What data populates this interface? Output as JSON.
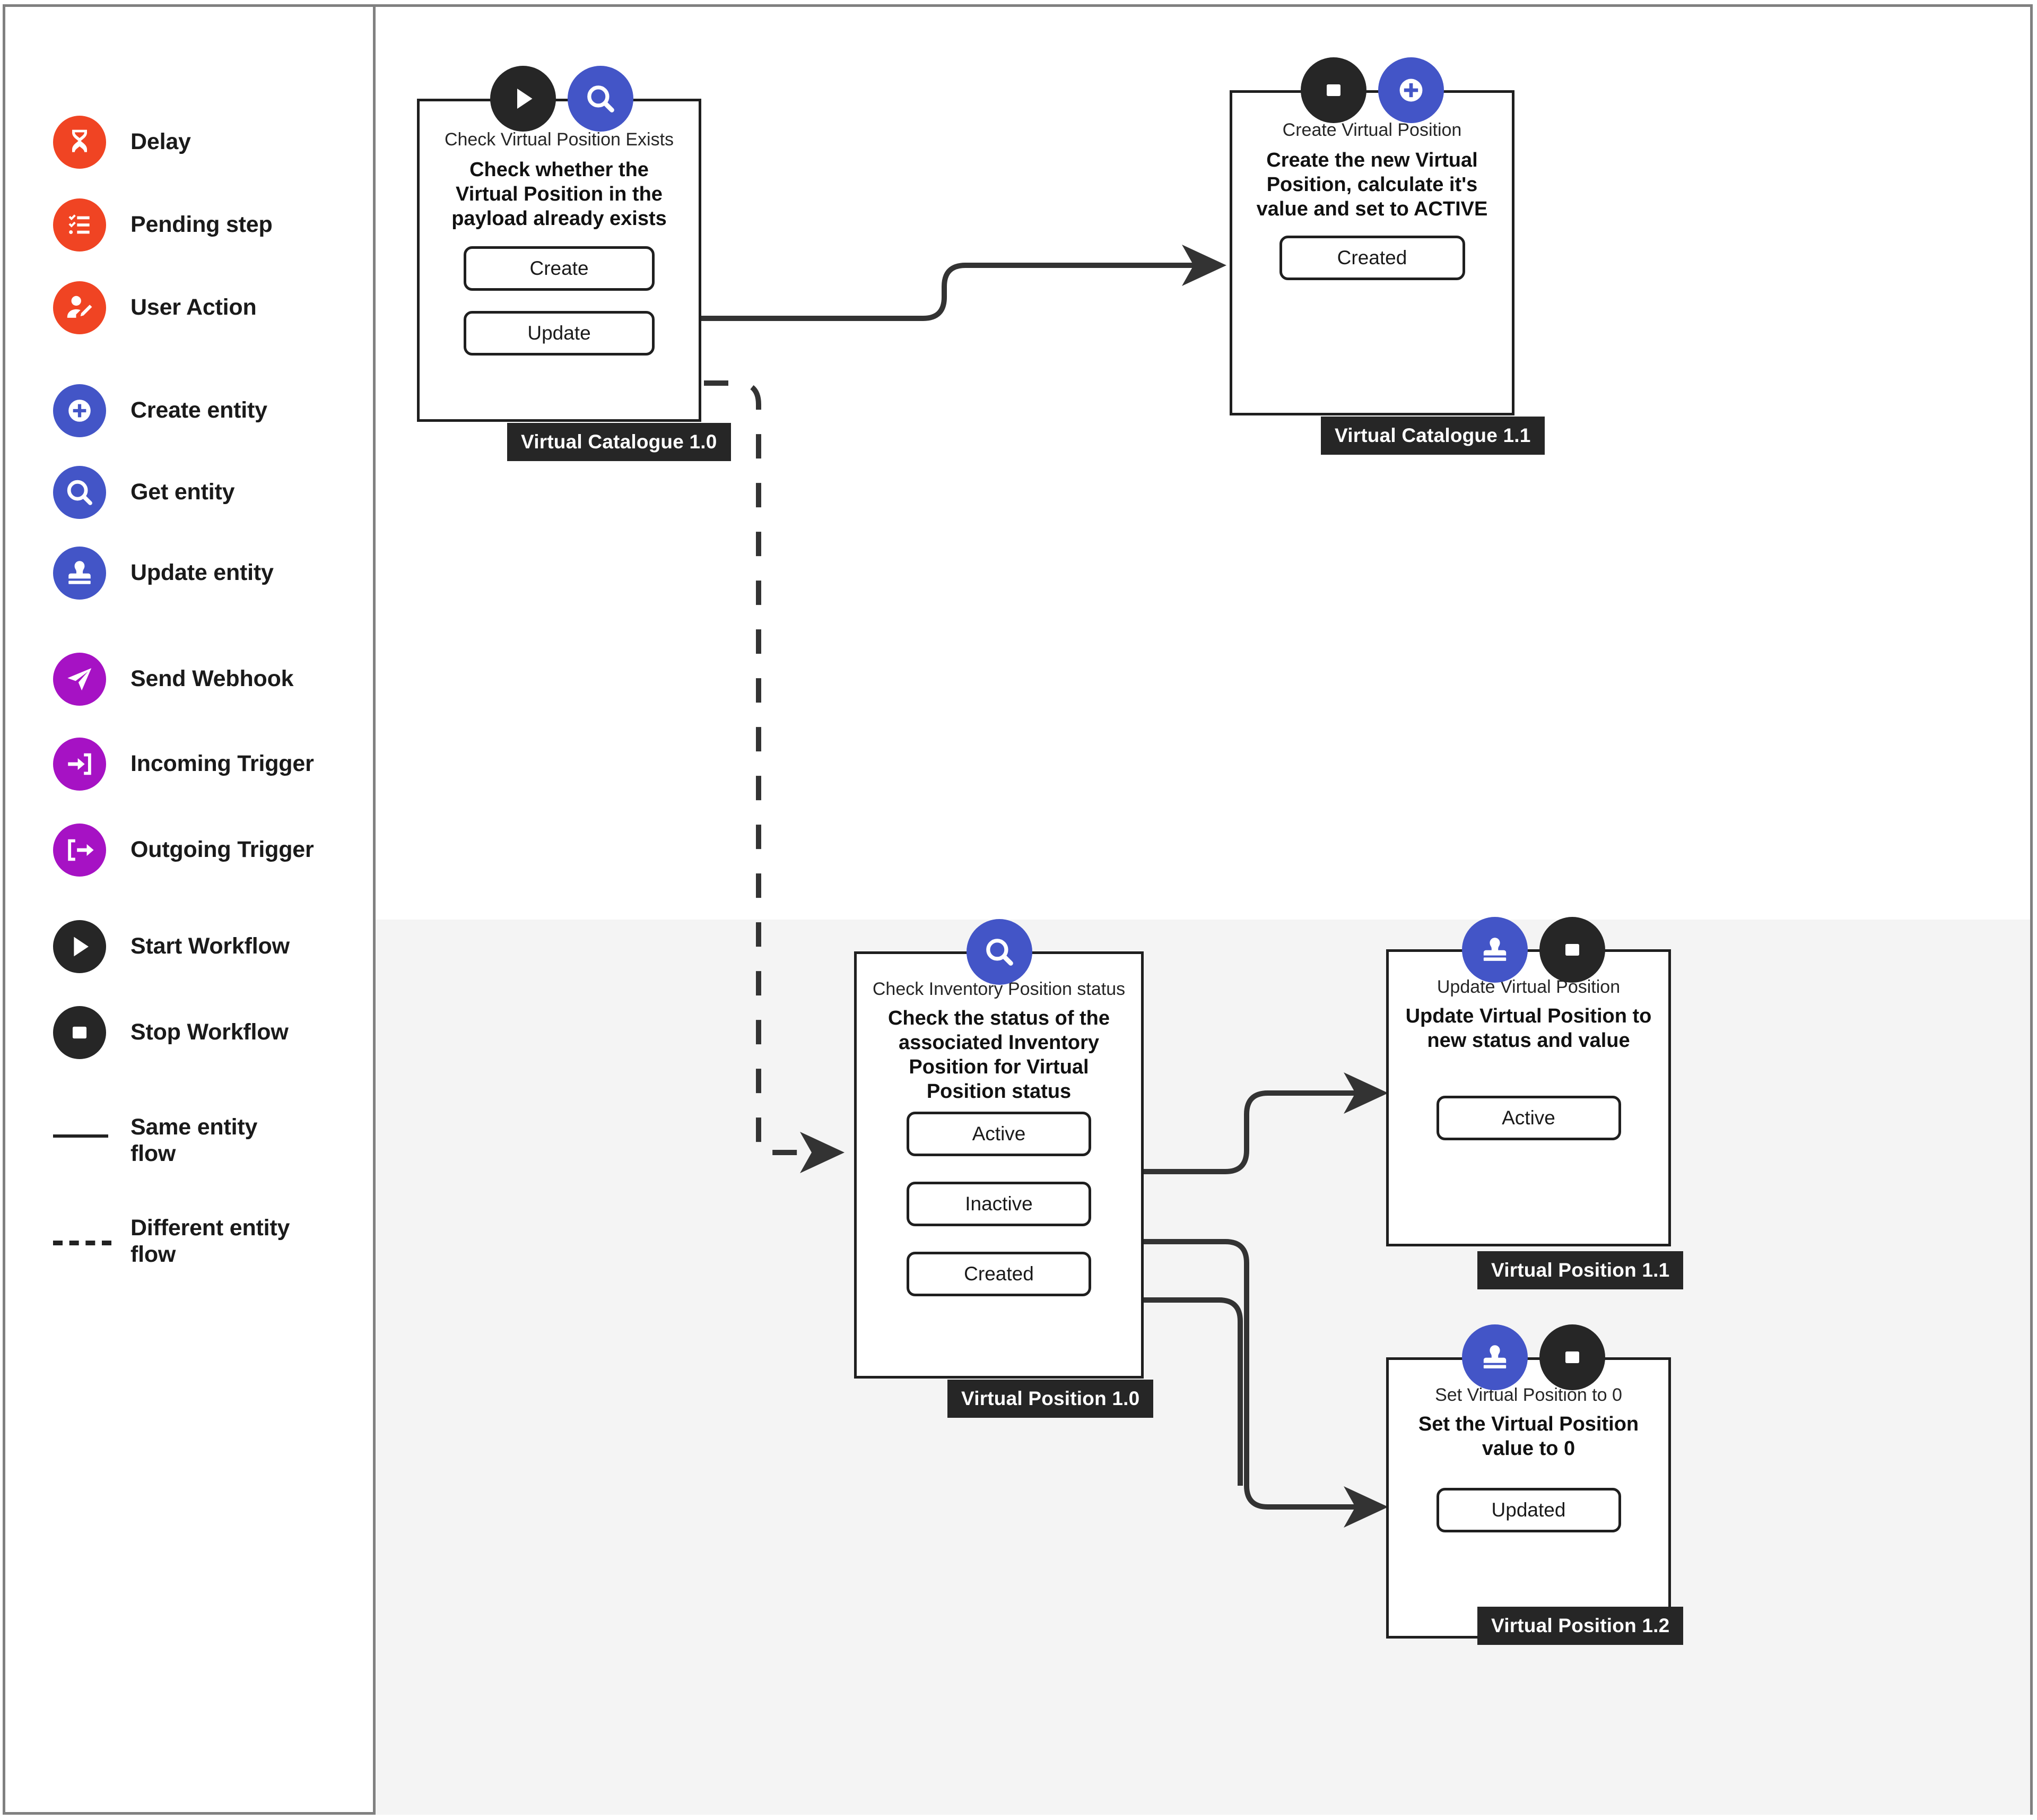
{
  "legend": {
    "items": [
      {
        "label": "Delay",
        "icon": "hourglass-icon",
        "color": "#f04423"
      },
      {
        "label": "Pending step",
        "icon": "checklist-icon",
        "color": "#f04423"
      },
      {
        "label": "User Action",
        "icon": "user-edit-icon",
        "color": "#f04423"
      },
      {
        "label": "Create entity",
        "icon": "plus-circle-icon",
        "color": "#4355c7"
      },
      {
        "label": "Get entity",
        "icon": "magnifier-icon",
        "color": "#4355c7"
      },
      {
        "label": "Update entity",
        "icon": "stamp-icon",
        "color": "#4355c7"
      },
      {
        "label": "Send Webhook",
        "icon": "paper-plane-icon",
        "color": "#a612c4"
      },
      {
        "label": "Incoming Trigger",
        "icon": "arrow-into-bracket-icon",
        "color": "#a612c4"
      },
      {
        "label": "Outgoing Trigger",
        "icon": "arrow-out-of-bracket-icon",
        "color": "#a612c4"
      },
      {
        "label": "Start Workflow",
        "icon": "play-icon",
        "color": "#262626"
      },
      {
        "label": "Stop Workflow",
        "icon": "stop-icon",
        "color": "#262626"
      }
    ],
    "lines": [
      {
        "label": "Same entity flow",
        "style": "solid"
      },
      {
        "label": "Different entity flow",
        "style": "dashed"
      }
    ]
  },
  "nodes": [
    {
      "id": "check-virtual-position-exists",
      "subtitle": "Check Virtual Position Exists",
      "title": "Check whether the Virtual Position in the payload already exists",
      "outputs": [
        "Create",
        "Update"
      ],
      "version": "Virtual Catalogue 1.0",
      "badges": [
        "start-workflow-icon",
        "get-entity-icon"
      ]
    },
    {
      "id": "create-virtual-position",
      "subtitle": "Create Virtual Position",
      "title": "Create the new Virtual Position, calculate it's value and set to ACTIVE",
      "outputs": [
        "Created"
      ],
      "version": "Virtual Catalogue 1.1",
      "badges": [
        "stop-workflow-icon",
        "create-entity-icon"
      ]
    },
    {
      "id": "check-inventory-position-status",
      "subtitle": "Check Inventory Position status",
      "title": "Check the status of the associated Inventory Position for Virtual Position status",
      "outputs": [
        "Active",
        "Inactive",
        "Created"
      ],
      "version": "Virtual Position 1.0",
      "badges": [
        "get-entity-icon"
      ]
    },
    {
      "id": "update-virtual-position",
      "subtitle": "Update Virtual Position",
      "title": "Update Virtual Position to new status and value",
      "outputs": [
        "Active"
      ],
      "version": "Virtual Position 1.1",
      "badges": [
        "update-entity-icon",
        "stop-workflow-icon"
      ]
    },
    {
      "id": "set-virtual-position-to-zero",
      "subtitle": "Set Virtual Position to 0",
      "title": "Set the Virtual Position value to 0",
      "outputs": [
        "Updated"
      ],
      "version": "Virtual Position 1.2",
      "badges": [
        "update-entity-icon",
        "stop-workflow-icon"
      ]
    }
  ],
  "colors": {
    "orange": "#f04423",
    "blue": "#4355c7",
    "purple": "#a612c4",
    "black": "#262626",
    "band": "#f4f4f4",
    "frame": "#808080"
  }
}
